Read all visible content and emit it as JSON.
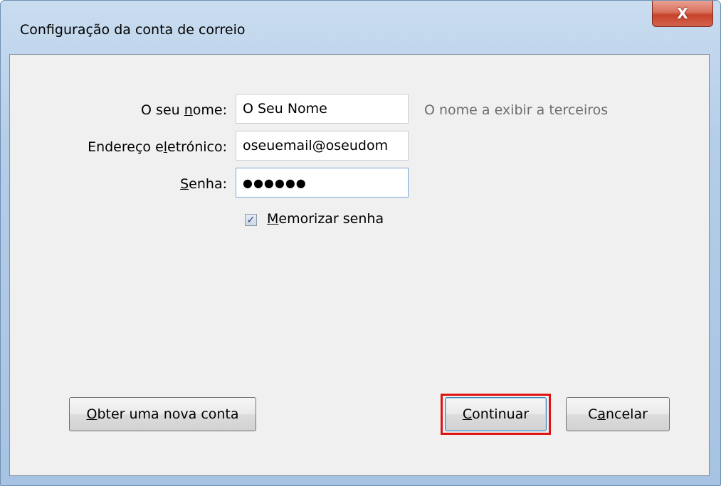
{
  "window": {
    "title": "Configuração da conta de correio",
    "close_label": "X"
  },
  "form": {
    "name": {
      "label_pre": "O seu ",
      "label_accel": "n",
      "label_post": "ome:",
      "value": "O Seu Nome",
      "hint": "O nome a exibir a terceiros"
    },
    "email": {
      "label_pre": "Endereço e",
      "label_accel": "l",
      "label_post": "etrónico:",
      "value": "oseuemail@oseudom"
    },
    "password": {
      "label_pre": "",
      "label_accel": "S",
      "label_post": "enha:",
      "value": "●●●●●●"
    },
    "remember": {
      "checked": true,
      "label_accel": "M",
      "label_post": "emorizar senha"
    }
  },
  "buttons": {
    "new_account": {
      "label_accel": "O",
      "label_post": "bter uma nova conta"
    },
    "continue": {
      "label_accel": "C",
      "label_post": "ontinuar"
    },
    "cancel": {
      "label_pre": "C",
      "label_accel": "a",
      "label_post": "ncelar"
    }
  },
  "colors": {
    "highlight": "#e01414",
    "hint_text": "#6d6d6d",
    "close_button": "#c7432b"
  }
}
